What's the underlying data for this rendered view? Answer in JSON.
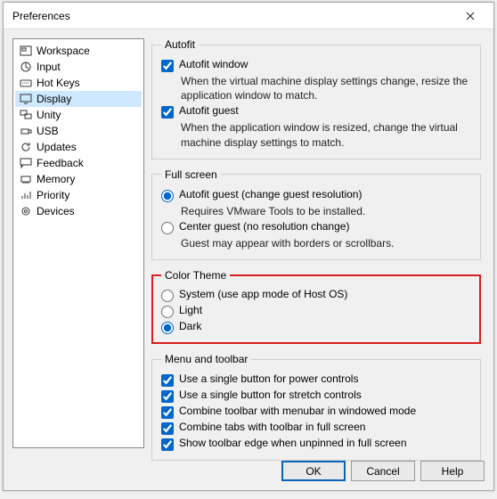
{
  "window": {
    "title": "Preferences"
  },
  "sidebar": {
    "items": [
      {
        "label": "Workspace",
        "icon": "workspace"
      },
      {
        "label": "Input",
        "icon": "input"
      },
      {
        "label": "Hot Keys",
        "icon": "hotkeys"
      },
      {
        "label": "Display",
        "icon": "display"
      },
      {
        "label": "Unity",
        "icon": "unity"
      },
      {
        "label": "USB",
        "icon": "usb"
      },
      {
        "label": "Updates",
        "icon": "updates"
      },
      {
        "label": "Feedback",
        "icon": "feedback"
      },
      {
        "label": "Memory",
        "icon": "memory"
      },
      {
        "label": "Priority",
        "icon": "priority"
      },
      {
        "label": "Devices",
        "icon": "devices"
      }
    ],
    "selected_index": 3
  },
  "sections": {
    "autofit": {
      "legend": "Autofit",
      "window_label": "Autofit window",
      "window_checked": true,
      "window_desc": "When the virtual machine display settings change, resize the application window to match.",
      "guest_label": "Autofit guest",
      "guest_checked": true,
      "guest_desc": "When the application window is resized, change the virtual machine display settings to match."
    },
    "fullscreen": {
      "legend": "Full screen",
      "opt1_label": "Autofit guest (change guest resolution)",
      "opt1_desc": "Requires VMware Tools to be installed.",
      "opt2_label": "Center guest (no resolution change)",
      "opt2_desc": "Guest may appear with borders or scrollbars.",
      "selected": "opt1"
    },
    "color_theme": {
      "legend": "Color Theme",
      "system_label": "System (use app mode of Host OS)",
      "light_label": "Light",
      "dark_label": "Dark",
      "selected": "dark"
    },
    "menu_toolbar": {
      "legend": "Menu and toolbar",
      "items": [
        {
          "label": "Use a single button for power controls",
          "checked": true
        },
        {
          "label": "Use a single button for stretch controls",
          "checked": true
        },
        {
          "label": "Combine toolbar with menubar in windowed mode",
          "checked": true
        },
        {
          "label": "Combine tabs with toolbar in full screen",
          "checked": true
        },
        {
          "label": "Show toolbar edge when unpinned in full screen",
          "checked": true
        }
      ]
    }
  },
  "buttons": {
    "ok": "OK",
    "cancel": "Cancel",
    "help": "Help"
  }
}
